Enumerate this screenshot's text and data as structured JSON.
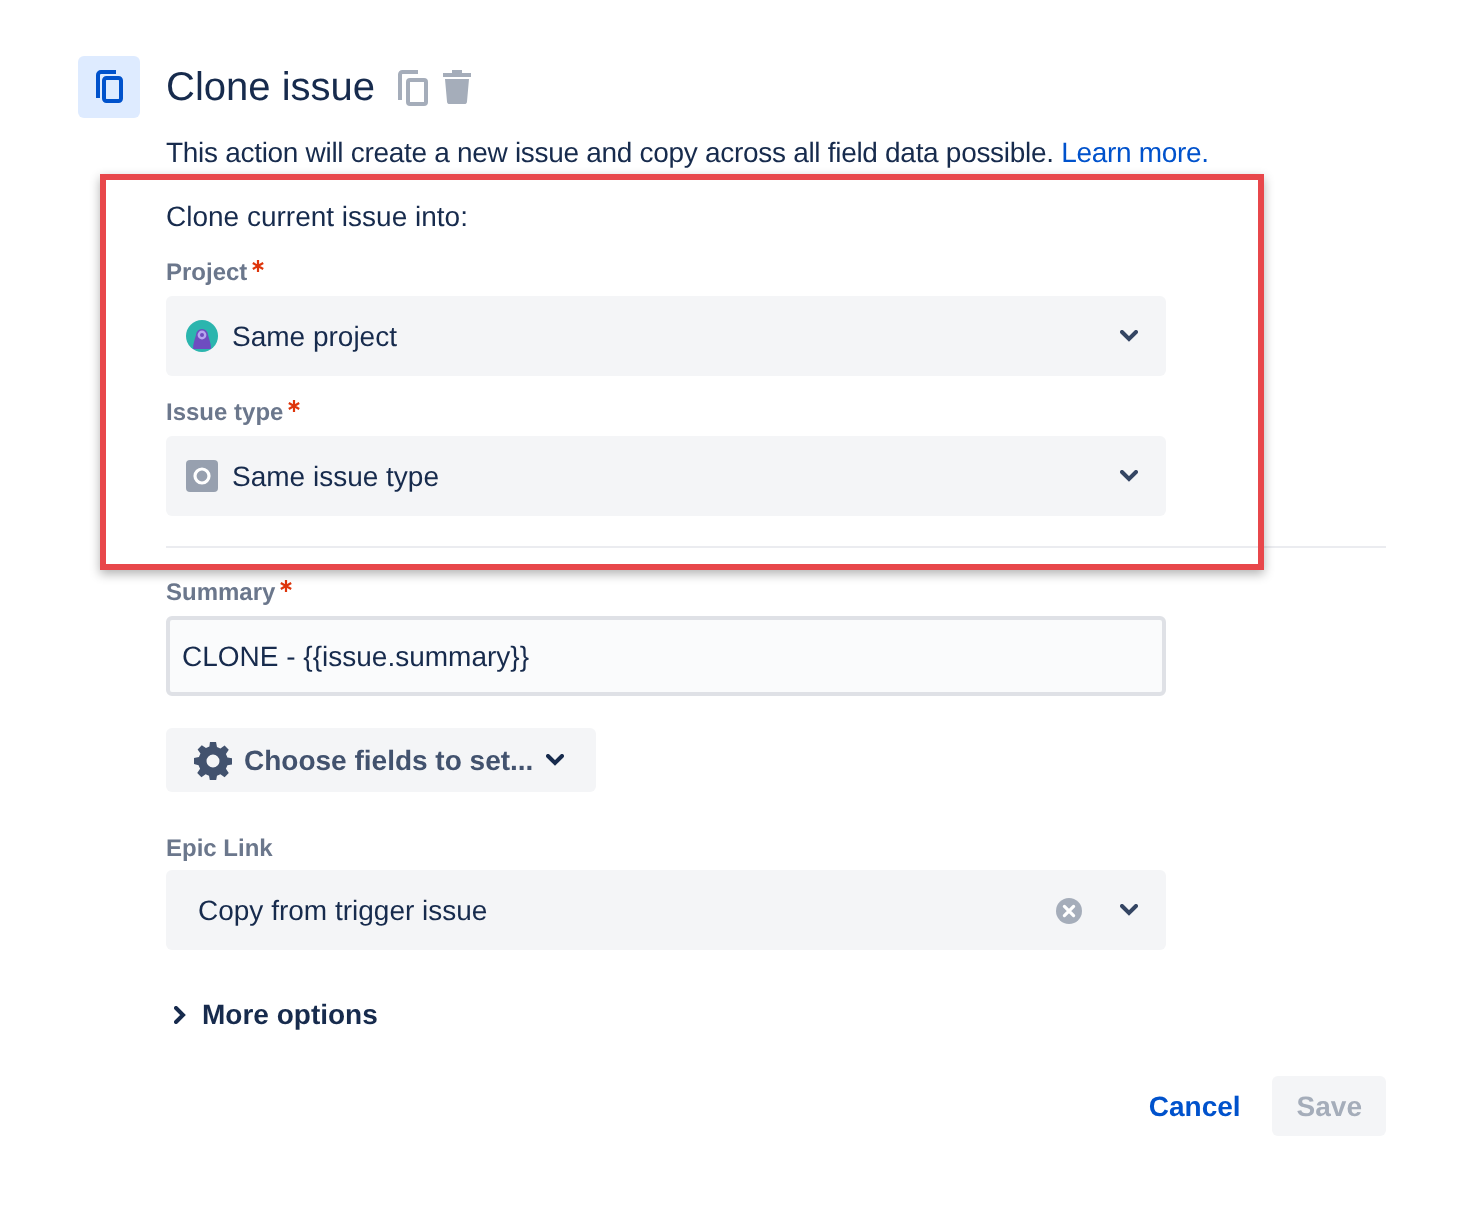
{
  "header": {
    "title": "Clone issue"
  },
  "description": {
    "text": "This action will create a new issue and copy across all field data possible.",
    "link": "Learn more."
  },
  "clone_target": {
    "highlighted": true,
    "intro": "Clone current issue into:",
    "fields": [
      {
        "kind": "project",
        "label": "Project",
        "required": true,
        "value": "Same project"
      },
      {
        "kind": "issuetype",
        "label": "Issue type",
        "required": true,
        "value": "Same issue type"
      }
    ]
  },
  "summary": {
    "label": "Summary",
    "required": true,
    "value": "CLONE - {{issue.summary}}"
  },
  "choose_fields_button": {
    "label": "Choose fields to set..."
  },
  "epic_link": {
    "label": "Epic Link",
    "required": false,
    "value": "Copy from trigger issue",
    "clearable": true
  },
  "more_options": {
    "label": "More options",
    "expanded": false
  },
  "actions": [
    {
      "kind": "link",
      "label": "Cancel",
      "disabled": false
    },
    {
      "kind": "button",
      "label": "Save",
      "disabled": true
    }
  ]
}
